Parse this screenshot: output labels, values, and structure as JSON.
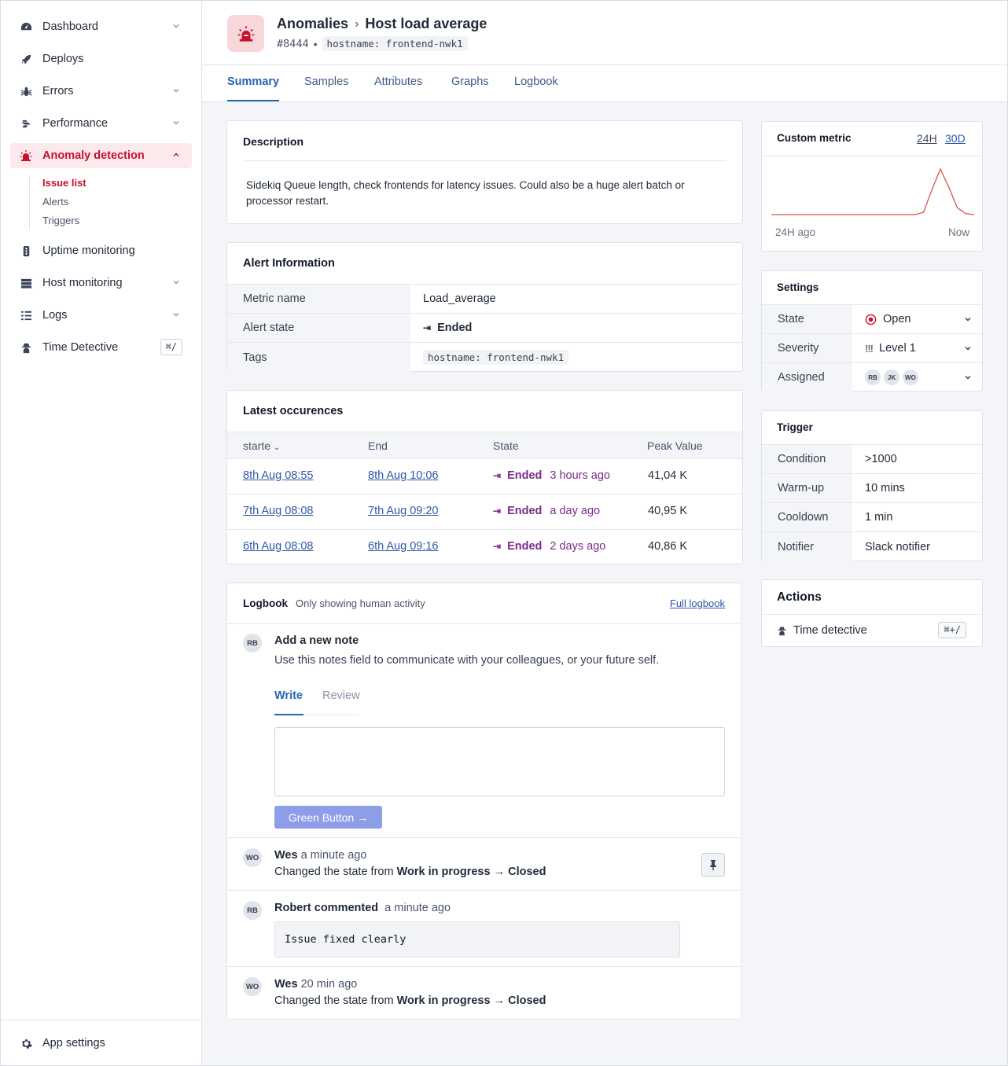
{
  "sidebar": {
    "items": [
      {
        "label": "Dashboard",
        "icon": "dashboard-icon"
      },
      {
        "label": "Deploys",
        "icon": "rocket-icon"
      },
      {
        "label": "Errors",
        "icon": "bug-icon"
      },
      {
        "label": "Performance",
        "icon": "performance-icon"
      },
      {
        "label": "Anomaly detection",
        "icon": "siren-icon"
      },
      {
        "label": "Uptime monitoring",
        "icon": "traffic-light-icon"
      },
      {
        "label": "Host monitoring",
        "icon": "server-icon"
      },
      {
        "label": "Logs",
        "icon": "logs-icon"
      },
      {
        "label": "Time Detective",
        "icon": "detective-icon",
        "shortcut": "⌘/"
      }
    ],
    "subitems": [
      "Issue list",
      "Alerts",
      "Triggers"
    ],
    "footer": {
      "label": "App settings",
      "icon": "gear-icon"
    }
  },
  "header": {
    "section": "Anomalies",
    "title": "Host load average",
    "issue_number": "#8444",
    "hostname_tag": "hostname: frontend-nwk1"
  },
  "tabs": [
    "Summary",
    "Samples",
    "Attributes",
    "Graphs",
    "Logbook"
  ],
  "description": {
    "title": "Description",
    "text": "Sidekiq Queue length, check frontends for latency issues. Could also be a huge alert batch or processor restart."
  },
  "alert_info": {
    "title": "Alert Information",
    "rows": [
      {
        "key": "Metric name",
        "value": "Load_average"
      },
      {
        "key": "Alert state",
        "value": "Ended"
      },
      {
        "key": "Tags",
        "value": "hostname: frontend-nwk1"
      }
    ]
  },
  "occurrences": {
    "title": "Latest occurences",
    "columns": [
      "starte",
      "End",
      "State",
      "Peak Value"
    ],
    "rows": [
      {
        "start": "8th Aug 08:55",
        "end": "8th Aug 10:06",
        "state": "Ended",
        "ago": "3 hours ago",
        "peak": "41,04 K"
      },
      {
        "start": "7th Aug 08:08",
        "end": "7th Aug 09:20",
        "state": "Ended",
        "ago": "a day ago",
        "peak": "40,95 K"
      },
      {
        "start": "6th Aug 08:08",
        "end": "6th Aug 09:16",
        "state": "Ended",
        "ago": "2 days ago",
        "peak": "40,86 K"
      }
    ]
  },
  "logbook": {
    "title": "Logbook",
    "subtitle": "Only showing human activity",
    "full_link": "Full logbook",
    "note": {
      "avatar": "RB",
      "title": "Add a new note",
      "hint": "Use this notes field to communicate with your colleagues, or your future self.",
      "tab_write": "Write",
      "tab_review": "Review",
      "button": "Green Button →"
    },
    "entries": [
      {
        "avatar": "WO",
        "author": "Wes",
        "time": "a minute ago",
        "prefix": "Changed the state from ",
        "from": "Work in progress",
        "arrow": " → ",
        "to": "Closed"
      },
      {
        "avatar": "RB",
        "author": "Robert commented",
        "time": "a minute ago",
        "comment": "Issue fixed clearly"
      },
      {
        "avatar": "WO",
        "author": "Wes",
        "time": "20 min ago",
        "prefix": "Changed the state from ",
        "from": "Work in progress",
        "arrow": " → ",
        "to": "Closed"
      }
    ]
  },
  "custom_metric": {
    "title": "Custom metric",
    "range_24h": "24H",
    "range_30d": "30D",
    "x_start": "24H ago",
    "x_end": "Now",
    "line_color": "#d9534f"
  },
  "chart_data": {
    "type": "line",
    "title": "Custom metric",
    "x": [
      0,
      1,
      2,
      3,
      4,
      5,
      6,
      7,
      8,
      9,
      10,
      11,
      12,
      13,
      14,
      15,
      16,
      17,
      18,
      19,
      20,
      21,
      22,
      23,
      24
    ],
    "series": [
      {
        "values": [
          0,
          0,
          0,
          0,
          0,
          0,
          0,
          0,
          0,
          0,
          0,
          0,
          0,
          0,
          0,
          0,
          0,
          0,
          0.05,
          0.55,
          1.0,
          0.6,
          0.15,
          0.02,
          0
        ]
      }
    ],
    "xlabel": "",
    "ylabel": "",
    "ylim": [
      0,
      1
    ],
    "grid": false
  },
  "settings": {
    "title": "Settings",
    "rows": [
      {
        "key": "State",
        "value": "Open"
      },
      {
        "key": "Severity",
        "value": "Level 1"
      },
      {
        "key": "Assigned",
        "avatars": [
          "RB",
          "JK",
          "WO"
        ]
      }
    ]
  },
  "trigger": {
    "title": "Trigger",
    "rows": [
      {
        "key": "Condition",
        "value": ">1000"
      },
      {
        "key": "Warm-up",
        "value": "10 mins"
      },
      {
        "key": "Cooldown",
        "value": "1 min"
      },
      {
        "key": "Notifier",
        "value": "Slack notifier"
      }
    ]
  },
  "actions": {
    "title": "Actions",
    "item": "Time detective",
    "shortcut": "⌘+/"
  },
  "colors": {
    "accent": "#2563b5",
    "danger": "#c8102e",
    "ended": "#7b2a8a",
    "button": "#8e9de8"
  }
}
